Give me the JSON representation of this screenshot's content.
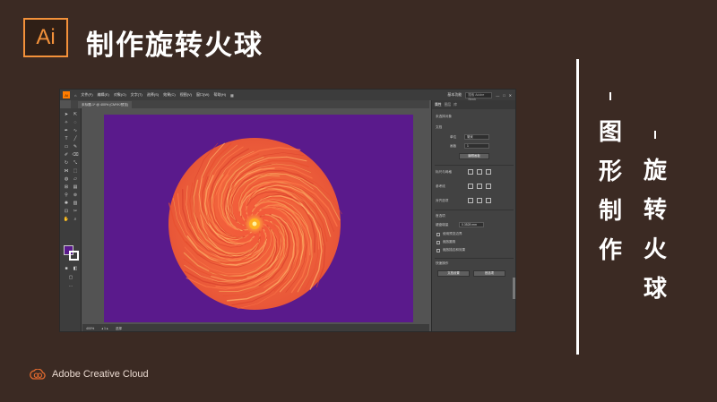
{
  "header": {
    "logo_text": "Ai",
    "title": "制作旋转火球"
  },
  "side_text": {
    "col1": [
      "图",
      "形",
      "制",
      "作"
    ],
    "col2": [
      "旋",
      "转",
      "火",
      "球"
    ]
  },
  "footer": {
    "brand": "Adobe Creative Cloud"
  },
  "app": {
    "menu": [
      "文件(F)",
      "编辑(E)",
      "对象(O)",
      "文字(T)",
      "选择(S)",
      "效果(C)",
      "视图(V)",
      "窗口(W)",
      "帮助(H)"
    ],
    "workspace": "基本功能",
    "search_placeholder": "搜索 Adobe Stock",
    "doc_tab": "未标题-1* @ 400% (CMYK/预览)",
    "zoom": "400%",
    "status_mode": "选择",
    "panel_tabs": [
      "属性",
      "图层",
      "库"
    ],
    "panel": {
      "section_title": "未选择对象",
      "doc_label": "文档",
      "unit_label": "单位",
      "unit_value": "毫米",
      "artboard_label": "画板",
      "artboard_value": "1",
      "edit_artboard_btn": "编辑画板",
      "ruler_label": "标尺与网格",
      "guides_label": "参考线",
      "snap_label": "对齐选项",
      "pref_title": "首选项",
      "keyboard_label": "键盘增量",
      "keyboard_value": "0.3528 mm",
      "check1": "使用预览边界",
      "check2": "缩放圆角",
      "check3": "缩放描边和效果",
      "quick_title": "快速操作",
      "btn_prefs": "文档设置",
      "btn_prefs2": "首选项"
    }
  },
  "colors": {
    "background": "#3b2a23",
    "accent": "#f3913a",
    "artboard": "#5a1a8c",
    "fireball_outer": "#f0623a",
    "fireball_core": "#ffb020"
  }
}
